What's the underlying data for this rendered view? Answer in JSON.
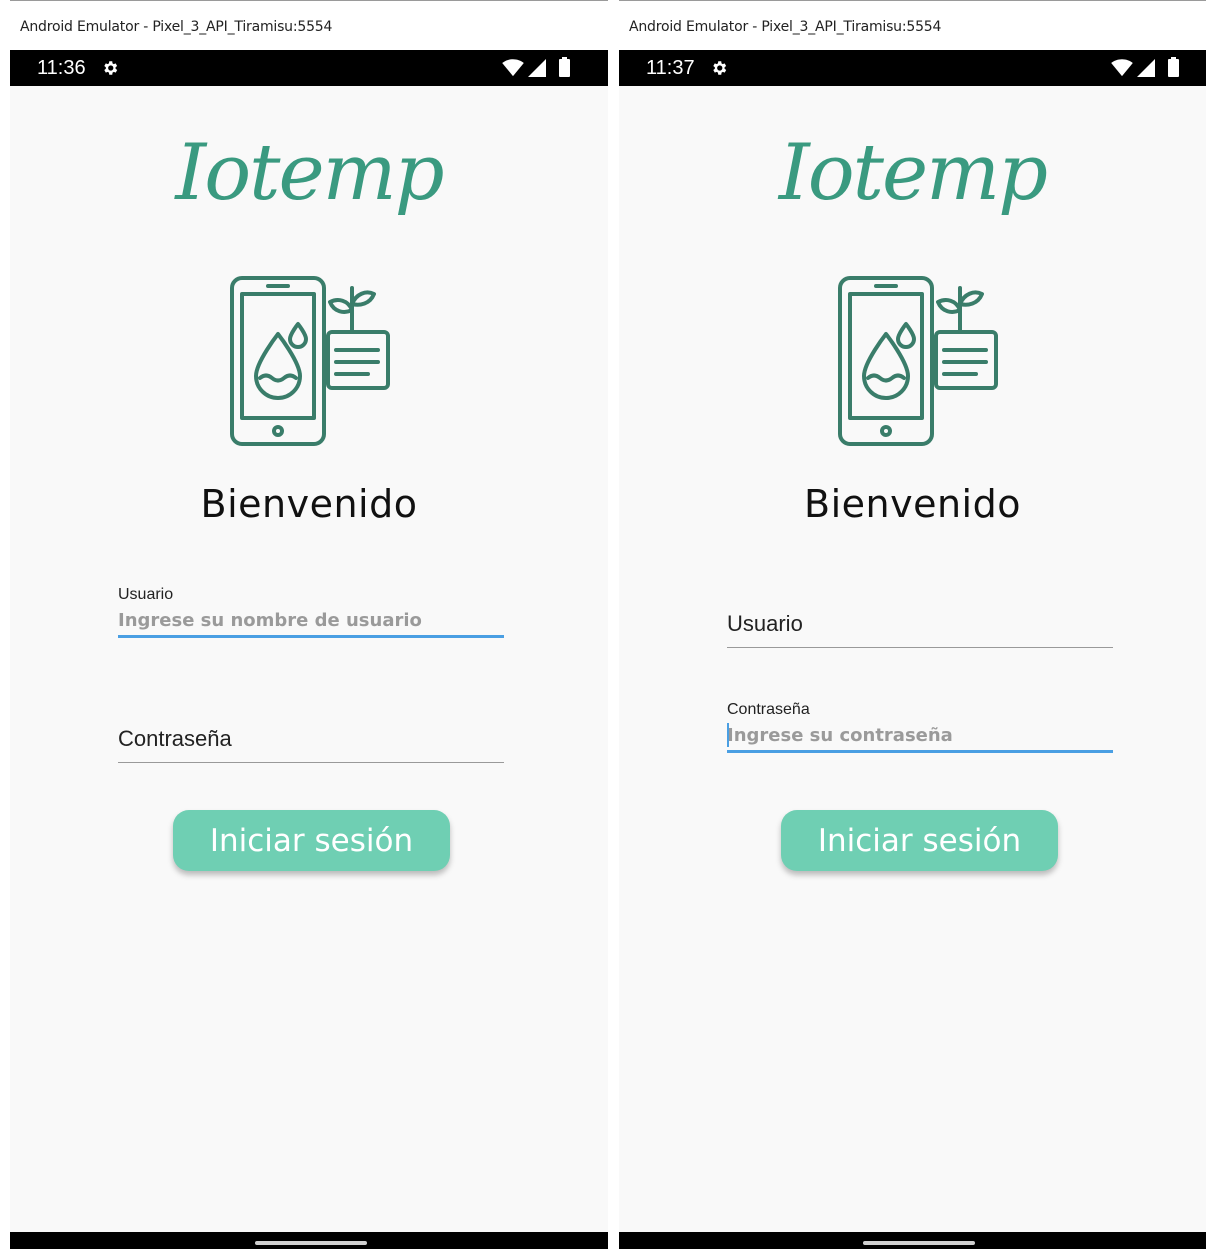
{
  "windows": [
    {
      "title": "Android Emulator - Pixel_3_API_Tiramisu:5554",
      "status_time": "11:36",
      "app": {
        "logo_text": "Iotemp",
        "welcome": "Bienvenido",
        "username": {
          "label": "Usuario",
          "placeholder": "Ingrese su nombre de usuario",
          "state": "focused"
        },
        "password": {
          "label": "Contraseña",
          "placeholder": "",
          "state": "idle"
        },
        "login_label": "Iniciar sesión"
      }
    },
    {
      "title": "Android Emulator - Pixel_3_API_Tiramisu:5554",
      "status_time": "11:37",
      "app": {
        "logo_text": "Iotemp",
        "welcome": "Bienvenido",
        "username": {
          "label": "Usuario",
          "placeholder": "",
          "state": "idle"
        },
        "password": {
          "label": "Contraseña",
          "placeholder": "Ingrese su contraseña",
          "state": "focused"
        },
        "login_label": "Iniciar sesión"
      }
    }
  ],
  "icons": {
    "status_left": "gear-icon",
    "status_right": [
      "wifi-icon",
      "signal-icon",
      "battery-icon"
    ],
    "illustration": "phone-water-plant-icon"
  },
  "colors": {
    "brand_green": "#3a9a80",
    "button_green": "#6fcfb3",
    "focus_blue": "#4a9fe3",
    "background": "#f9f9f9"
  }
}
